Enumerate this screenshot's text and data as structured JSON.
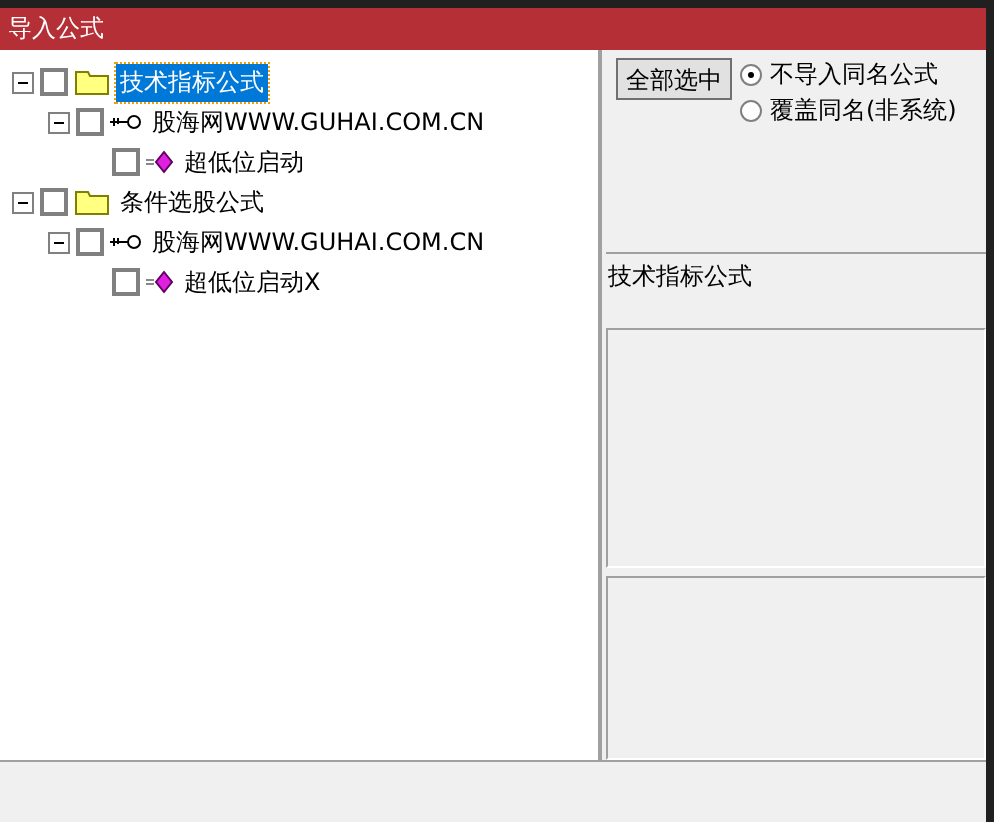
{
  "window": {
    "title": "导入公式"
  },
  "tree": [
    {
      "label": "技术指标公式",
      "kind": "folder",
      "expanded": true,
      "checked": false,
      "selected": true,
      "children": [
        {
          "label": "股海网WWW.GUHAI.COM.CN",
          "kind": "key",
          "expanded": true,
          "checked": false,
          "selected": false,
          "children": [
            {
              "label": "超低位启动",
              "kind": "formula",
              "checked": false,
              "selected": false
            }
          ]
        }
      ]
    },
    {
      "label": "条件选股公式",
      "kind": "folder",
      "expanded": true,
      "checked": false,
      "selected": false,
      "children": [
        {
          "label": "股海网WWW.GUHAI.COM.CN",
          "kind": "key",
          "expanded": true,
          "checked": false,
          "selected": false,
          "children": [
            {
              "label": "超低位启动X",
              "kind": "formula",
              "checked": false,
              "selected": false
            }
          ]
        }
      ]
    }
  ],
  "select_all_button": "全部选中",
  "options": [
    {
      "label": "不导入同名公式",
      "selected": true
    },
    {
      "label": "覆盖同名(非系统)",
      "selected": false
    }
  ],
  "category_label": "技术指标公式"
}
